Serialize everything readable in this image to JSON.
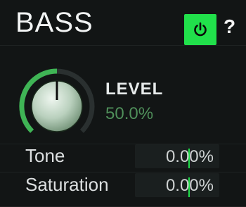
{
  "header": {
    "title": "BASS",
    "power_icon": "power-icon",
    "help_label": "?"
  },
  "level": {
    "label": "LEVEL",
    "value": "50.0%",
    "fraction": 0.5
  },
  "params": [
    {
      "label": "Tone",
      "value": "0.00%"
    },
    {
      "label": "Saturation",
      "value": "0.00%"
    }
  ],
  "colors": {
    "accent": "#21e04b",
    "value_green": "#4f8f5a",
    "background": "#121515"
  }
}
